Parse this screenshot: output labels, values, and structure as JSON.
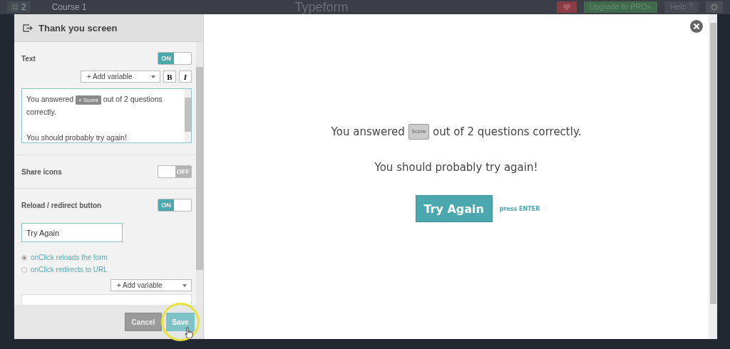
{
  "app_bar": {
    "count": "2",
    "course": "Course 1",
    "title": "Typeform",
    "upgrade": "Upgrade to PRO»",
    "help": "Help ?"
  },
  "panel": {
    "title": "Thank you screen",
    "text_section": {
      "label": "Text",
      "on": true,
      "toggle_text": "ON",
      "add_variable": "+ Add variable",
      "bold": "B",
      "italic": "I",
      "before": "You answered",
      "chip_remove": "×",
      "chip": "Score",
      "after": "out of 2 questions correctly.",
      "line2": "You should probably try again!"
    },
    "share_section": {
      "label": "Share icons",
      "on": false,
      "toggle_text": "OFF"
    },
    "reload_section": {
      "label": "Reload / redirect button",
      "on": true,
      "toggle_text": "ON",
      "button_text": "Try Again",
      "options": [
        {
          "label": "onClick reloads the form",
          "selected": true
        },
        {
          "label": "onClick redirects to URL",
          "selected": false
        }
      ],
      "add_variable": "+ Add variable"
    },
    "cancel": "Cancel",
    "save": "Save"
  },
  "preview": {
    "before": "You answered",
    "chip": "Score",
    "after": "out of 2 questions correctly.",
    "line2": "You should probably try again!",
    "button": "Try Again",
    "hint": "press ENTER"
  }
}
